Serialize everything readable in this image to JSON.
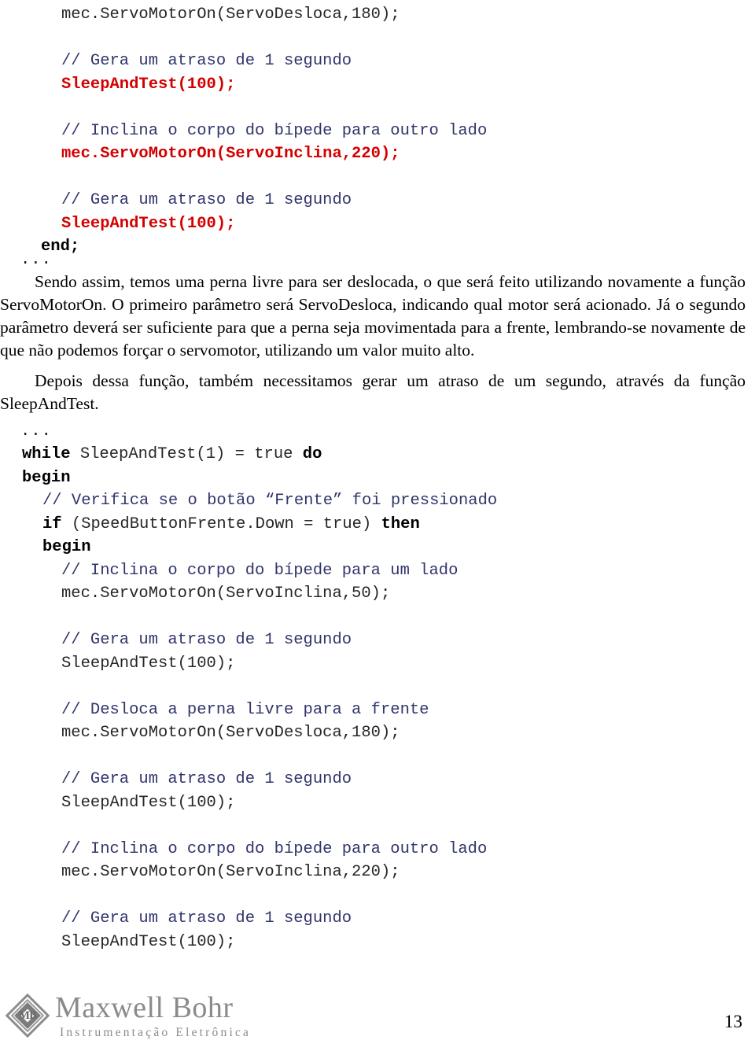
{
  "document": {
    "page_number": "13",
    "colors": {
      "comment": "#31356b",
      "highlight_red": "#d40000",
      "keyword": "#000000",
      "body_text": "#000000",
      "logo_gray": "#8a8a8a"
    }
  },
  "code_top": {
    "lines": [
      {
        "indent": 78,
        "segments": [
          {
            "style": "plain",
            "text": "mec.ServoMotorOn(ServoDesloca,180);"
          }
        ]
      },
      {
        "indent": 0,
        "segments": []
      },
      {
        "indent": 78,
        "segments": [
          {
            "style": "comment",
            "text": "// Gera um atraso de 1 segundo"
          }
        ]
      },
      {
        "indent": 78,
        "segments": [
          {
            "style": "red",
            "text": "SleepAndTest(100);"
          }
        ]
      },
      {
        "indent": 0,
        "segments": []
      },
      {
        "indent": 78,
        "segments": [
          {
            "style": "comment",
            "text": "// Inclina o corpo do bípede para outro lado"
          }
        ]
      },
      {
        "indent": 78,
        "segments": [
          {
            "style": "red",
            "text": "mec.ServoMotorOn(ServoInclina,220);"
          }
        ]
      },
      {
        "indent": 0,
        "segments": []
      },
      {
        "indent": 78,
        "segments": [
          {
            "style": "comment",
            "text": "// Gera um atraso de 1 segundo"
          }
        ]
      },
      {
        "indent": 78,
        "segments": [
          {
            "style": "red",
            "text": "SleepAndTest(100);"
          }
        ]
      },
      {
        "indent": 52,
        "segments": [
          {
            "style": "kw",
            "text": "end;"
          }
        ]
      }
    ]
  },
  "ellipsis_1": "...",
  "paragraph_1": "Sendo assim, temos uma perna livre para ser deslocada, o que será feito utilizando novamente a função ServoMotorOn. O primeiro parâmetro será ServoDesloca, indicando qual motor será acionado. Já o segundo parâmetro deverá ser suficiente para que a perna seja movimentada para a frente, lembrando-se novamente de que não podemos forçar o servomotor, utilizando um valor muito alto.",
  "paragraph_2": "Depois dessa função, também necessitamos gerar um atraso de um segundo, através da função SleepAndTest.",
  "ellipsis_2": "...",
  "code_bottom": {
    "lines": [
      {
        "indent": 28,
        "segments": [
          {
            "style": "kw",
            "text": "while "
          },
          {
            "style": "plain",
            "text": "SleepAndTest(1) = true "
          },
          {
            "style": "kw",
            "text": "do"
          }
        ]
      },
      {
        "indent": 28,
        "segments": [
          {
            "style": "kw",
            "text": "begin"
          }
        ]
      },
      {
        "indent": 54,
        "segments": [
          {
            "style": "comment",
            "text": "// Verifica se o botão “Frente” foi pressionado"
          }
        ]
      },
      {
        "indent": 54,
        "segments": [
          {
            "style": "kw",
            "text": "if "
          },
          {
            "style": "plain",
            "text": "(SpeedButtonFrente.Down = true) "
          },
          {
            "style": "kw",
            "text": "then"
          }
        ]
      },
      {
        "indent": 54,
        "segments": [
          {
            "style": "kw",
            "text": "begin"
          }
        ]
      },
      {
        "indent": 78,
        "segments": [
          {
            "style": "comment",
            "text": "// Inclina o corpo do bípede para um lado"
          }
        ]
      },
      {
        "indent": 78,
        "segments": [
          {
            "style": "plain",
            "text": "mec.ServoMotorOn(ServoInclina,50);"
          }
        ]
      },
      {
        "indent": 0,
        "segments": []
      },
      {
        "indent": 78,
        "segments": [
          {
            "style": "comment",
            "text": "// Gera um atraso de 1 segundo"
          }
        ]
      },
      {
        "indent": 78,
        "segments": [
          {
            "style": "plain",
            "text": "SleepAndTest(100);"
          }
        ]
      },
      {
        "indent": 0,
        "segments": []
      },
      {
        "indent": 78,
        "segments": [
          {
            "style": "comment",
            "text": "// Desloca a perna livre para a frente"
          }
        ]
      },
      {
        "indent": 78,
        "segments": [
          {
            "style": "plain",
            "text": "mec.ServoMotorOn(ServoDesloca,180);"
          }
        ]
      },
      {
        "indent": 0,
        "segments": []
      },
      {
        "indent": 78,
        "segments": [
          {
            "style": "comment",
            "text": "// Gera um atraso de 1 segundo"
          }
        ]
      },
      {
        "indent": 78,
        "segments": [
          {
            "style": "plain",
            "text": "SleepAndTest(100);"
          }
        ]
      },
      {
        "indent": 0,
        "segments": []
      },
      {
        "indent": 78,
        "segments": [
          {
            "style": "comment",
            "text": "// Inclina o corpo do bípede para outro lado"
          }
        ]
      },
      {
        "indent": 78,
        "segments": [
          {
            "style": "plain",
            "text": "mec.ServoMotorOn(ServoInclina,220);"
          }
        ]
      },
      {
        "indent": 0,
        "segments": []
      },
      {
        "indent": 78,
        "segments": [
          {
            "style": "comment",
            "text": "// Gera um atraso de 1 segundo"
          }
        ]
      },
      {
        "indent": 78,
        "segments": [
          {
            "style": "plain",
            "text": "SleepAndTest(100);"
          }
        ]
      }
    ]
  },
  "footer": {
    "logo_monogram": "MB",
    "logo_title": "Maxwell Bohr",
    "logo_subtitle": "Instrumentação Eletrônica",
    "page_number": "13"
  }
}
